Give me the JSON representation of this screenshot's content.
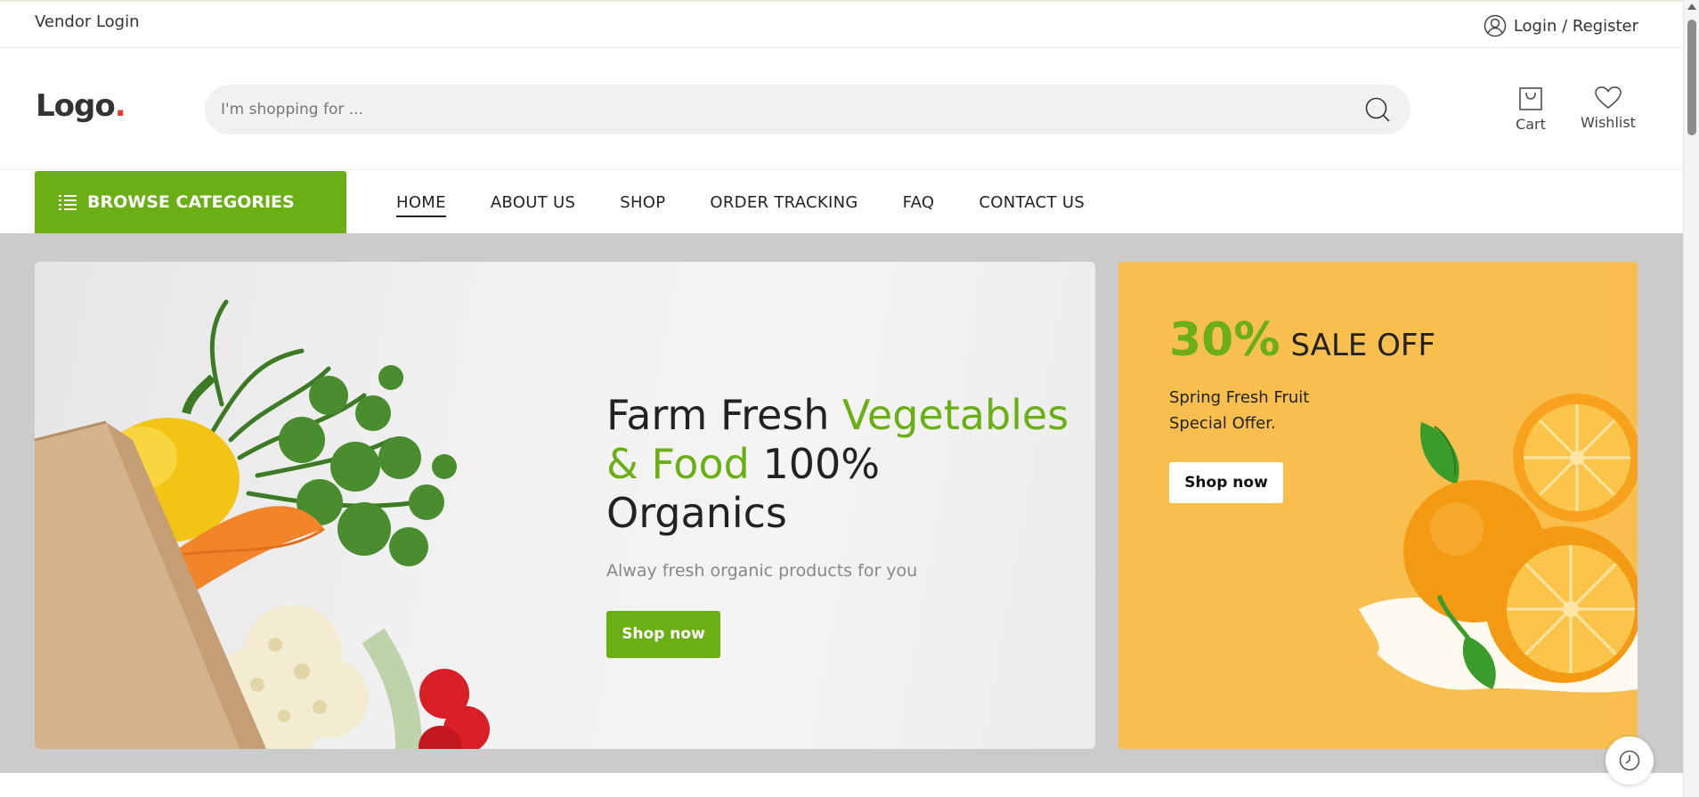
{
  "topbar": {
    "vendor_login": "Vendor Login",
    "login_register": "Login / Register",
    "user_icon": "user-circle-icon"
  },
  "header": {
    "logo_text": "Logo",
    "logo_dot": ".",
    "search": {
      "placeholder": "I'm shopping for ...",
      "value": "",
      "icon": "search-icon"
    },
    "cart": {
      "label": "Cart",
      "icon": "shopping-bag-icon"
    },
    "wishlist": {
      "label": "Wishlist",
      "icon": "heart-icon"
    }
  },
  "nav": {
    "browse_label": "BROWSE CATEGORIES",
    "browse_icon": "list-icon",
    "items": [
      {
        "label": "HOME",
        "active": true
      },
      {
        "label": "ABOUT US",
        "active": false
      },
      {
        "label": "SHOP",
        "active": false
      },
      {
        "label": "ORDER TRACKING",
        "active": false
      },
      {
        "label": "FAQ",
        "active": false
      },
      {
        "label": "CONTACT US",
        "active": false
      }
    ]
  },
  "hero": {
    "title_dark_1": "Farm Fresh",
    "title_green": "Vegetables & Food",
    "title_dark_2": "100% Organics",
    "subtitle": "Alway fresh organic products for you",
    "cta": "Shop now"
  },
  "promo": {
    "percent": "30%",
    "headline": "SALE OFF",
    "line1": "Spring Fresh Fruit",
    "line2": "Special Offer.",
    "cta": "Shop now"
  },
  "floating": {
    "history_icon": "clock-icon"
  },
  "colors": {
    "accent_green": "#6aaf13",
    "promo_bg": "#f8bf4e",
    "hero_bg": "#cbcbcb"
  }
}
